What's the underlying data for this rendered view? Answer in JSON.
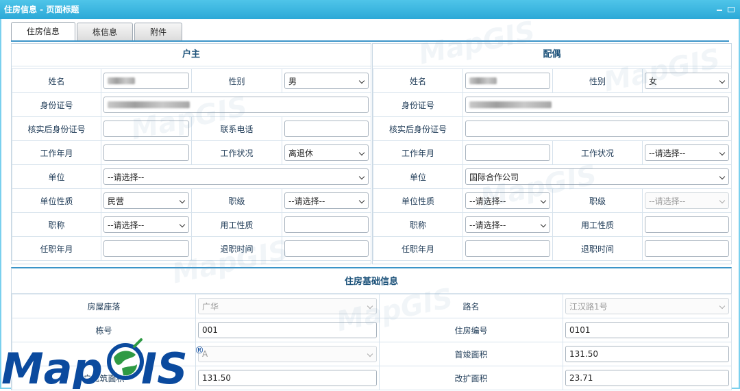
{
  "window": {
    "title": "住房信息 - 页面标题"
  },
  "tabs": [
    {
      "label": "住房信息",
      "active": true
    },
    {
      "label": "栋信息",
      "active": false
    },
    {
      "label": "附件",
      "active": false
    }
  ],
  "owner": {
    "heading": "户主",
    "labels": {
      "name": "姓名",
      "gender": "性别",
      "id": "身份证号",
      "verified_id": "核实后身份证号",
      "phone": "联系电话",
      "work_start": "工作年月",
      "work_status": "工作状况",
      "unit": "单位",
      "unit_type": "单位性质",
      "rank": "职级",
      "title": "职称",
      "employment": "用工性质",
      "appoint_date": "任职年月",
      "retire_date": "退职时间"
    },
    "values": {
      "gender": "男",
      "work_status": "离退休",
      "unit": "--请选择--",
      "unit_type": "民营",
      "rank": "--请选择--",
      "title": "--请选择--"
    }
  },
  "spouse": {
    "heading": "配偶",
    "labels": {
      "name": "姓名",
      "gender": "性别",
      "id": "身份证号",
      "verified_id": "核实后身份证号",
      "work_start": "工作年月",
      "work_status": "工作状况",
      "unit": "单位",
      "unit_type": "单位性质",
      "rank": "职级",
      "title": "职称",
      "employment": "用工性质",
      "appoint_date": "任职年月",
      "retire_date": "退职时间"
    },
    "values": {
      "gender": "女",
      "work_status": "--请选择--",
      "unit": "国际合作公司",
      "unit_type": "--请选择--",
      "rank": "--请选择--",
      "title": "--请选择--"
    }
  },
  "housing": {
    "heading": "住房基础信息",
    "labels": {
      "location": "房屋座落",
      "road": "路名",
      "building_no": "栋号",
      "house_no": "住房编号",
      "first_area": "首竣面积",
      "unit_area": "户建筑面积",
      "ext_area": "改扩面积"
    },
    "values": {
      "location": "广华",
      "road": "江汉路1号",
      "building_no": "001",
      "house_no": "0101",
      "type": "A",
      "first_area": "131.50",
      "unit_area": "131.50",
      "ext_area": "23.71"
    }
  },
  "logo": {
    "text": "MapGIS",
    "mark": "®"
  },
  "colors": {
    "titlebar": "#2ba8d7",
    "accent": "#3a94c8",
    "logo_blue": "#0b4a9e",
    "logo_green": "#2f9a44"
  }
}
